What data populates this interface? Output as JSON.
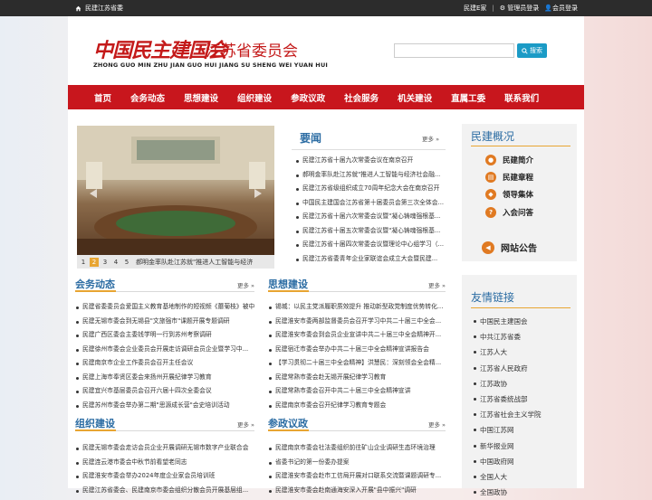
{
  "topbar": {
    "site_name": "民建江苏省委",
    "home_link": "民建E家",
    "admin_login": "管理员登录",
    "member_login": "会员登录"
  },
  "header": {
    "logo_calligraphy": "中国民主建国会",
    "logo_subtitle": "江苏省委员会",
    "logo_pinyin": "ZHONG GUO MIN ZHU JIAN GUO HUI JIANG SU SHENG WEI YUAN HUI",
    "search_placeholder": "",
    "search_button": "搜索"
  },
  "nav": [
    "首页",
    "会务动态",
    "思想建设",
    "组织建设",
    "参政议政",
    "社会服务",
    "机关建设",
    "直属工委",
    "联系我们"
  ],
  "slider": {
    "pages": [
      "1",
      "2",
      "3",
      "4",
      "5"
    ],
    "active_page": "2",
    "caption": "郝明金率队赴江苏就\"推进人工智能与经济"
  },
  "news": {
    "title": "要闻",
    "more": "更多 »",
    "items": [
      "民建江苏省十届九次常委会议在南京召开",
      "郝明金率队赴江苏就\"推进人工智能与经济社会融...",
      "民建江苏省级组织成立70周年纪念大会在南京召开",
      "中国民主建国会江苏省第十届委员会第三次全体会...",
      "民建江苏省十届六次常委会议暨\"凝心铸魂强根基...",
      "民建江苏省十届五次常委会议暨\"凝心铸魂强根基...",
      "民建江苏省十届四次常委会议暨理论中心组学习（...",
      "民建江苏省委青年企业家联谊会成立大会暨民建..."
    ]
  },
  "overview": {
    "title": "民建概况",
    "items": [
      "民建简介",
      "民建章程",
      "领导集体",
      "入会问答"
    ]
  },
  "announcement": {
    "title": "网站公告"
  },
  "friend_links": {
    "title": "友情链接",
    "items": [
      "中国民主建国会",
      "中共江苏省委",
      "江苏人大",
      "江苏省人民政府",
      "江苏政协",
      "江苏省委统战部",
      "江苏省社会主义学院",
      "中国江苏网",
      "新华报业网",
      "中国政府网",
      "全国人大",
      "全国政协"
    ]
  },
  "sections": [
    {
      "title": "会务动态",
      "more": "更多 »",
      "items": [
        "民建省委委员会爱国主义教育基地制作的短视频《蘑菊枝》被中...",
        "民建无锡市委会到无锡县\"文旅强市\"课题开展专题调研",
        "民建广西区委会主委钱学明一行到苏州考察调研",
        "民建徐州市委会企业委员会开展走访调研会员企业暨学习中...",
        "民建南京市企业工作委员会召开主任会议",
        "民建上海市奉贤区委会来扬州开展纪律学习教育",
        "民建宜兴市基层委员会召开六届十四次全委会议",
        "民建苏州市委会举办第二期\"思源成长营\"会史培训活动"
      ]
    },
    {
      "title": "思想建设",
      "more": "更多 »",
      "items": [
        "锡城：以民主党派履职质效提升 推动新型政党制度优势转化...",
        "民建淮安市委两部监督委员会召开学习中共二十届三中全会...",
        "民建淮安市委会到会员企业宣讲中共二十届三中全会精神开...",
        "民建宿迁市委会举办中共二十届三中全会精神宣讲报告会",
        "【学习贯彻二十届三中全会精神】洪慧民：深刻领会全会精...",
        "民建常熟市委会赴无锡开展纪律学习教育",
        "民建常熟市委会召开中共二十届三中全会精神宣讲",
        "民建南京市委会召开纪律学习教育专题会"
      ]
    },
    {
      "title": "组织建设",
      "more": "更多 »",
      "items": [
        "民建无锡市委会走访会员企业开展调研无锡市数字产业联合会",
        "民建连云港市委会中秋节前看望老同志",
        "民建淮安市委会举办2024年度企业家会员培训班",
        "民建江苏省委会、民建南京市委会组织分散会员开展基层组..."
      ]
    },
    {
      "title": "参政议政",
      "more": "更多 »",
      "items": [
        "民建南京市委会社法委组织前往矿山企业调研生态环境治理",
        "省委书记的第一份委办提案",
        "民建淮安市委会赴市工信局开展对口联系交流暨课题调研专...",
        "民建淮安市委会赴南通海安深入开展\"县中振兴\"调研"
      ]
    }
  ],
  "colors": {
    "brand_red": "#c8161d",
    "accent_orange": "#e8a532",
    "title_blue": "#2b6ca3",
    "search_blue": "#1b9bc6"
  }
}
